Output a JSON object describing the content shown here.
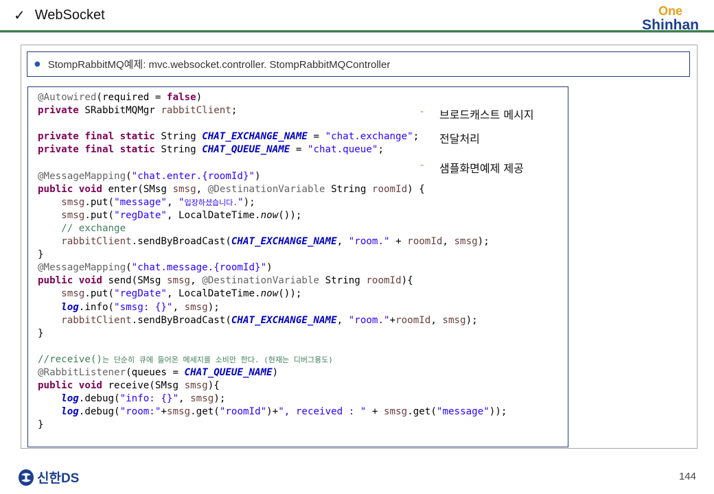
{
  "header": {
    "check_icon": "checkmark-icon",
    "title": "WebSocket",
    "logo_one": "One",
    "logo_shinhan": "Shinhan"
  },
  "subtitle": {
    "text": "StompRabbitMQ예제: mvc.websocket.controller. StompRabbitMQController"
  },
  "notes": {
    "item1_line1": "브로드캐스트 메시지",
    "item1_line2": "전달처리",
    "item2": "샘플화면예제 제공"
  },
  "footer": {
    "logo_text": "신한DS",
    "page_number": "144"
  },
  "colors": {
    "accent_green": "#3a7f4b",
    "brand_blue": "#1c3f8f",
    "brand_gold": "#e6a019",
    "dash_orange": "#e07a2a"
  }
}
